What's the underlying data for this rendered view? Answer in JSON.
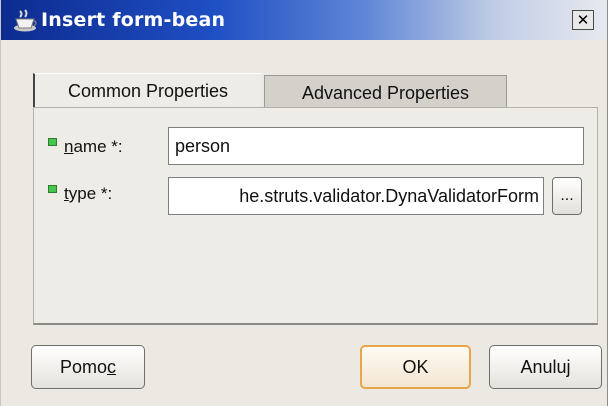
{
  "window": {
    "title": "Insert form-bean",
    "close_label": "✕"
  },
  "tabs": [
    {
      "label": "Common Properties",
      "selected": true
    },
    {
      "label": "Advanced Properties",
      "selected": false
    }
  ],
  "fields": {
    "name": {
      "label_mnemonic": "n",
      "label_rest": "ame *:",
      "value": "person"
    },
    "type": {
      "label_mnemonic": "t",
      "label_rest": "ype *:",
      "value": "he.struts.validator.DynaValidatorForm",
      "browse_label": "..."
    }
  },
  "buttons": {
    "help_prefix": "Pomo",
    "help_mnemonic": "c",
    "ok": "OK",
    "cancel": "Anuluj"
  },
  "colors": {
    "required_marker": "#46c64b",
    "default_button_border": "#e8a64a"
  }
}
